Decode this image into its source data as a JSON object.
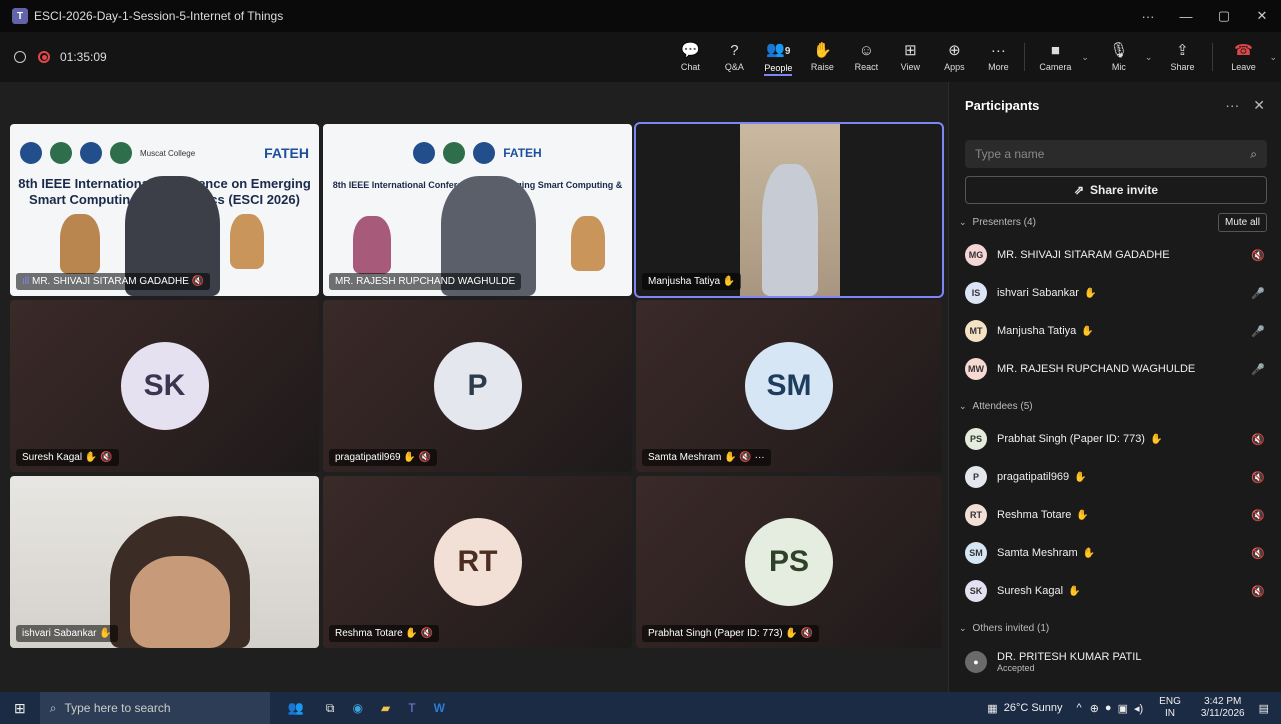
{
  "window": {
    "title": "ESCI-2026-Day-1-Session-5-Internet of Things",
    "controls": [
      "···",
      "—",
      "▢",
      "✕"
    ]
  },
  "meeting": {
    "elapsed": "01:35:09"
  },
  "toolbar": {
    "buttons": [
      {
        "label": "Chat",
        "icon": "💬"
      },
      {
        "label": "Q&A",
        "icon": "?"
      },
      {
        "label": "People",
        "icon": "👥",
        "count": "9"
      },
      {
        "label": "Raise",
        "icon": "✋"
      },
      {
        "label": "React",
        "icon": "☺"
      },
      {
        "label": "View",
        "icon": "⊞"
      },
      {
        "label": "Apps",
        "icon": "⊕"
      },
      {
        "label": "More",
        "icon": "···"
      }
    ],
    "camera": "Camera",
    "mic": "Mic",
    "share": "Share",
    "leave": "Leave"
  },
  "tiles": [
    {
      "name": "MR. SHIVAJI SITARAM GADADHE",
      "kind": "video"
    },
    {
      "name": "MR. RAJESH RUPCHAND WAGHULDE",
      "kind": "video"
    },
    {
      "name": "Manjusha Tatiya",
      "kind": "video"
    },
    {
      "name": "Suresh Kagal",
      "initials": "SK",
      "color": "#e6e1f0",
      "fg": "#3a3550"
    },
    {
      "name": "pragatipatil969",
      "initials": "P",
      "color": "#e4e8ee",
      "fg": "#2c3a4a"
    },
    {
      "name": "Samta Meshram",
      "initials": "SM",
      "color": "#d6e6f5",
      "fg": "#1e3c5e"
    },
    {
      "name": "ishvari Sabankar",
      "kind": "video"
    },
    {
      "name": "Reshma Totare",
      "initials": "RT",
      "color": "#f2dfd6",
      "fg": "#4a2e22"
    },
    {
      "name": "Prabhat Singh (Paper ID: 773)",
      "initials": "PS",
      "color": "#e4ede0",
      "fg": "#2f4228"
    }
  ],
  "slide": {
    "conference": "8th IEEE International Conference on Emerging Smart Computing & Informatics",
    "short": "(ESCI 2026)",
    "sponsor": "FATEH",
    "partner": "Muscat College"
  },
  "panel": {
    "title": "Participants",
    "search_placeholder": "Type a name",
    "invite": "Share invite",
    "mute_all": "Mute all",
    "presenters_label": "Presenters (4)",
    "presenters": [
      {
        "initials": "MG",
        "name": "MR. SHIVAJI SITARAM GADADHE",
        "color": "#f5d6d6",
        "raise": false,
        "mic": "🔇"
      },
      {
        "initials": "IS",
        "name": "ishvari Sabankar",
        "color": "#dde4f5",
        "raise": true,
        "mic": "🎤"
      },
      {
        "initials": "MT",
        "name": "Manjusha Tatiya",
        "color": "#f5e1c4",
        "raise": true,
        "mic": "🎤"
      },
      {
        "initials": "MW",
        "name": "MR. RAJESH RUPCHAND WAGHULDE",
        "color": "#f5d9d2",
        "raise": false,
        "mic": "🎤"
      }
    ],
    "attendees_label": "Attendees (5)",
    "attendees": [
      {
        "initials": "PS",
        "name": "Prabhat Singh (Paper ID: 773)",
        "color": "#e3ecdd",
        "raise": true,
        "mic": "🔇"
      },
      {
        "initials": "P",
        "name": "pragatipatil969",
        "color": "#e4e8ee",
        "raise": true,
        "mic": "🔇"
      },
      {
        "initials": "RT",
        "name": "Reshma Totare",
        "color": "#f2dfd6",
        "raise": true,
        "mic": "🔇"
      },
      {
        "initials": "SM",
        "name": "Samta Meshram",
        "color": "#d6e6f5",
        "raise": true,
        "mic": "🔇"
      },
      {
        "initials": "SK",
        "name": "Suresh Kagal",
        "color": "#e6e1f0",
        "raise": true,
        "mic": "🔇"
      }
    ],
    "others_label": "Others invited (1)",
    "others": [
      {
        "name": "DR. PRITESH KUMAR PATIL",
        "status": "Accepted"
      }
    ]
  },
  "taskbar": {
    "search": "Type here to search",
    "weather": "26°C  Sunny",
    "lang": "ENG",
    "region": "IN",
    "time": "3:42 PM",
    "date": "3/11/2026"
  }
}
